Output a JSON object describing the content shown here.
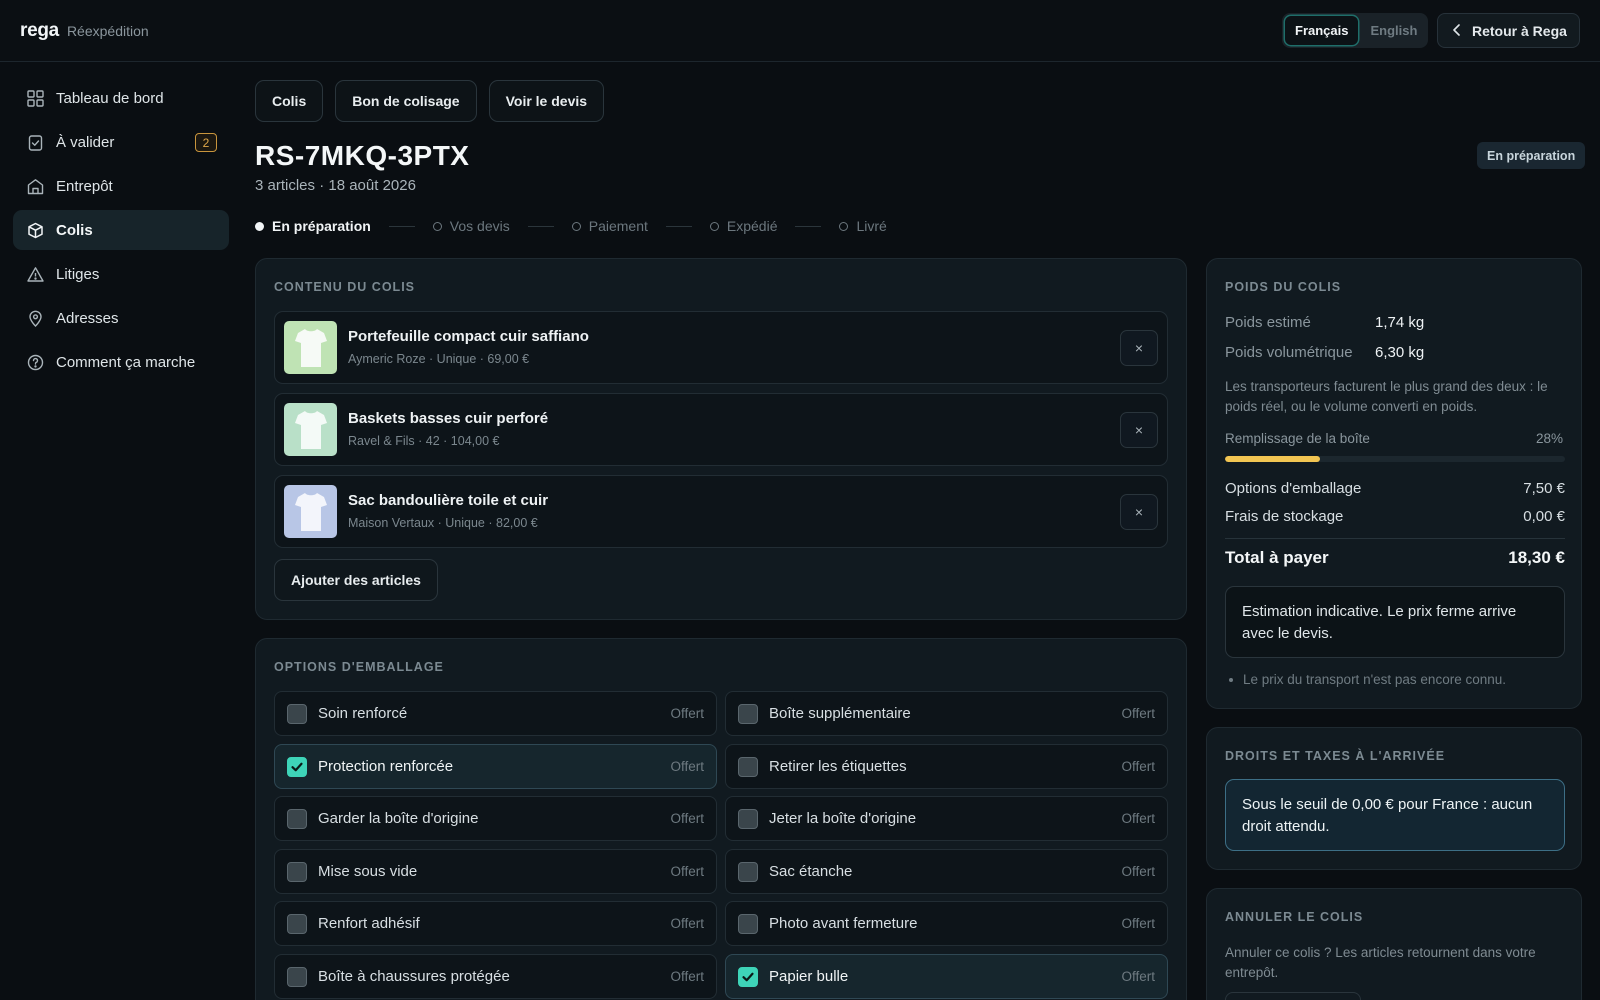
{
  "app": {
    "logo": "rega",
    "section": "Réexpédition"
  },
  "lang": {
    "fr": "Français",
    "en": "English"
  },
  "header": {
    "back_label": "Retour à Rega"
  },
  "sidebar": {
    "items": [
      {
        "label": "Tableau de bord",
        "icon": "grid-icon"
      },
      {
        "label": "À valider",
        "icon": "clipboard-check-icon",
        "badge": "2"
      },
      {
        "label": "Entrepôt",
        "icon": "warehouse-icon"
      },
      {
        "label": "Colis",
        "icon": "box-icon",
        "active": true
      },
      {
        "label": "Litiges",
        "icon": "warning-icon"
      },
      {
        "label": "Adresses",
        "icon": "map-pin-icon"
      },
      {
        "label": "Comment ça marche",
        "icon": "help-circle-icon"
      }
    ]
  },
  "tabs": [
    "Colis",
    "Bon de colisage",
    "Voir le devis"
  ],
  "parcel": {
    "ref": "RS-7MKQ-3PTX",
    "meta": "3 articles · 18 août 2026",
    "status": "En préparation"
  },
  "steps": [
    "En préparation",
    "Vos devis",
    "Paiement",
    "Expédié",
    "Livré"
  ],
  "contents": {
    "title": "Contenu du colis",
    "items": [
      {
        "name": "Portefeuille compact cuir saffiano",
        "meta": "Aymeric Roze · Unique · 69,00 €",
        "color": "#bfe3b4"
      },
      {
        "name": "Baskets basses cuir perforé",
        "meta": "Ravel & Fils · 42 · 104,00 €",
        "color": "#b9e0c8"
      },
      {
        "name": "Sac bandoulière toile et cuir",
        "meta": "Maison Vertaux · Unique · 82,00 €",
        "color": "#b8c6e6"
      }
    ],
    "remove_label": "×",
    "add_label": "Ajouter des articles"
  },
  "packing": {
    "title": "Options d'emballage",
    "options": [
      {
        "label": "Soin renforcé",
        "price": "Offert",
        "checked": false
      },
      {
        "label": "Boîte supplémentaire",
        "price": "Offert",
        "checked": false
      },
      {
        "label": "Protection renforcée",
        "price": "Offert",
        "checked": true
      },
      {
        "label": "Retirer les étiquettes",
        "price": "Offert",
        "checked": false
      },
      {
        "label": "Garder la boîte d'origine",
        "price": "Offert",
        "checked": false
      },
      {
        "label": "Jeter la boîte d'origine",
        "price": "Offert",
        "checked": false
      },
      {
        "label": "Mise sous vide",
        "price": "Offert",
        "checked": false
      },
      {
        "label": "Sac étanche",
        "price": "Offert",
        "checked": false
      },
      {
        "label": "Renfort adhésif",
        "price": "Offert",
        "checked": false
      },
      {
        "label": "Photo avant fermeture",
        "price": "Offert",
        "checked": false
      },
      {
        "label": "Boîte à chaussures protégée",
        "price": "Offert",
        "checked": false
      },
      {
        "label": "Papier bulle",
        "price": "Offert",
        "checked": true
      }
    ]
  },
  "weight": {
    "title": "Poids du colis",
    "estimated_label": "Poids estimé",
    "estimated_value": "1,74 kg",
    "volumetric_label": "Poids volumétrique",
    "volumetric_value": "6,30 kg",
    "note": "Les transporteurs facturent le plus grand des deux : le poids réel, ou le volume converti en poids.",
    "fill_label": "Remplissage de la boîte",
    "fill_percent_text": "28%",
    "fill_fraction": 0.28,
    "packing_label": "Options d'emballage",
    "packing_value": "7,50 €",
    "storage_label": "Frais de stockage",
    "storage_value": "0,00 €",
    "total_label": "Total à payer",
    "total_value": "18,30 €",
    "estimate_note": "Estimation indicative. Le prix ferme arrive avec le devis.",
    "bullet": "Le prix du transport n'est pas encore connu."
  },
  "duties": {
    "title": "Droits et taxes à l'arrivée",
    "text": "Sous le seuil de 0,00 € pour France : aucun droit attendu."
  },
  "cancel": {
    "title": "Annuler le colis",
    "text": "Annuler ce colis ? Les articles retournent dans votre entrepôt."
  },
  "colors": {
    "accent": "#3ed4b8",
    "fill_bar": "#f2c552",
    "badge": "#e0a84a"
  }
}
